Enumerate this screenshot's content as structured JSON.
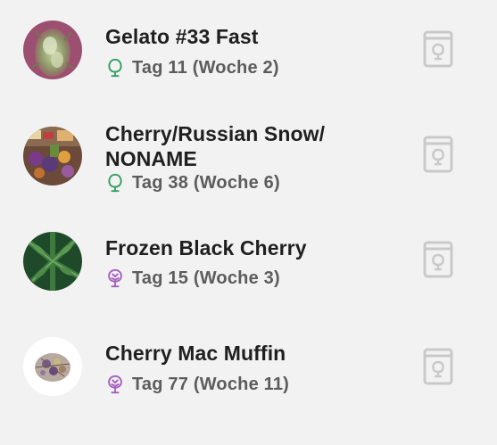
{
  "colors": {
    "background": "#f2f2f2",
    "title_text": "#1f1f1f",
    "sub_text": "#5c5c5c",
    "veg_stage": "#2e9d5e",
    "flower_stage": "#a35cbf",
    "diary_icon": "#c9c9c9"
  },
  "grows": [
    {
      "name": "Gelato #33 Fast",
      "stage": "Tag 11 (Woche 2)",
      "stage_icon": "tree-outline-icon",
      "diary_icon": "diary-book-icon"
    },
    {
      "name": "Cherry/Russian Snow/\nNONAME",
      "stage": "Tag 38 (Woche 6)",
      "stage_icon": "tree-outline-icon",
      "diary_icon": "diary-book-icon"
    },
    {
      "name": "Frozen Black Cherry",
      "stage": "Tag 15 (Woche 3)",
      "stage_icon": "flower-tree-icon",
      "diary_icon": "diary-book-icon"
    },
    {
      "name": "Cherry Mac Muffin",
      "stage": "Tag 77 (Woche 11)",
      "stage_icon": "flower-tree-icon",
      "diary_icon": "diary-book-icon"
    }
  ]
}
